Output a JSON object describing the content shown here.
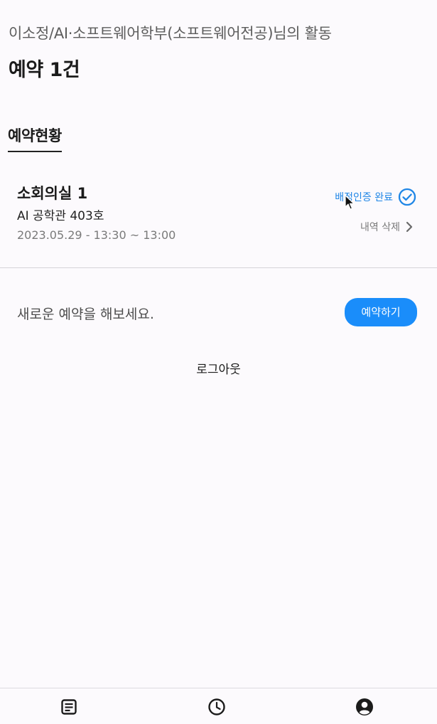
{
  "header": {
    "user_activity": "이소정/AI·소프트웨어학부(소프트웨어전공)님의 활동",
    "summary": "예약 1건"
  },
  "tabs": {
    "status_label": "예약현황"
  },
  "reservation": {
    "room_name": "소회의실 1",
    "location": "AI 공학관 403호",
    "datetime": "2023.05.29 - 13:30 ~ 13:00",
    "status_label": "배정인증 완료",
    "status_icon": "check-circle-icon",
    "delete_label": "내역 삭제",
    "delete_icon": "chevron-right-icon"
  },
  "new_reservation": {
    "prompt": "새로운 예약을 해보세요.",
    "button_label": "예약하기"
  },
  "logout_label": "로그아웃",
  "bottom_nav": {
    "items": [
      {
        "icon": "document-list-icon"
      },
      {
        "icon": "clock-icon"
      },
      {
        "icon": "account-circle-icon"
      }
    ]
  },
  "colors": {
    "accent": "#1a8dfa",
    "status_blue": "#1f86e6",
    "background": "#fcfafd"
  }
}
